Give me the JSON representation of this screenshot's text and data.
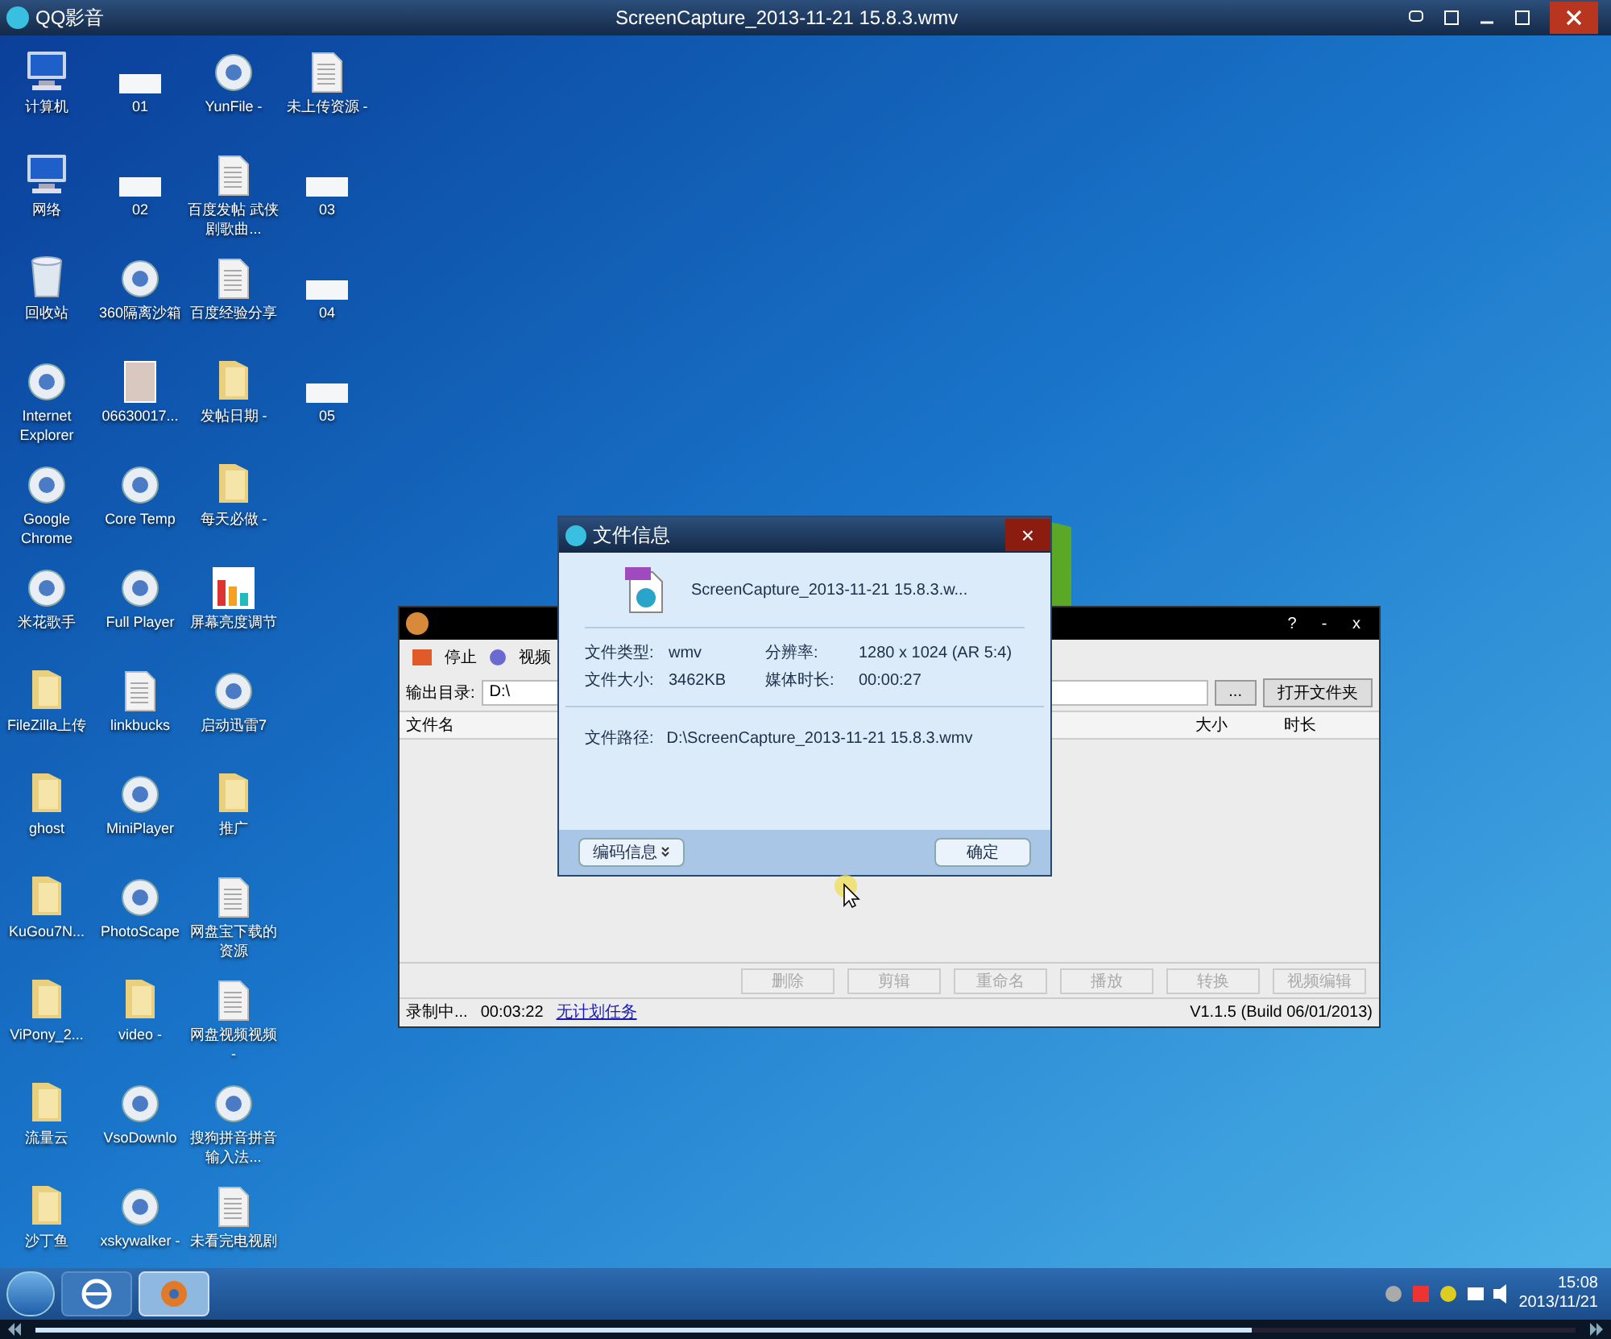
{
  "player": {
    "app_name": "QQ影音",
    "title": "ScreenCapture_2013-11-21 15.8.3.wmv",
    "progress": {
      "level": 0.79
    }
  },
  "desktop_rows": [
    [
      {
        "label": "计算机",
        "kind": "computer"
      },
      {
        "label": "01",
        "kind": "blank"
      },
      {
        "label": "YunFile -",
        "kind": "app"
      },
      {
        "label": "未上传资源 -",
        "kind": "document"
      }
    ],
    [
      {
        "label": "网络",
        "kind": "computer"
      },
      {
        "label": "02",
        "kind": "blank"
      },
      {
        "label": "百度发帖 武侠剧歌曲...",
        "kind": "document"
      },
      {
        "label": "03",
        "kind": "blank"
      }
    ],
    [
      {
        "label": "回收站",
        "kind": "bin"
      },
      {
        "label": "360隔离沙箱",
        "kind": "app"
      },
      {
        "label": "百度经验分享",
        "kind": "document"
      },
      {
        "label": "04",
        "kind": "blank"
      }
    ],
    [
      {
        "label": "Internet Explorer",
        "kind": "app"
      },
      {
        "label": "06630017...",
        "kind": "photo"
      },
      {
        "label": "发帖日期 -",
        "kind": "folder"
      },
      {
        "label": "05",
        "kind": "blank"
      }
    ],
    [
      {
        "label": "Google Chrome",
        "kind": "app"
      },
      {
        "label": "Core Temp",
        "kind": "app"
      },
      {
        "label": "每天必做 -",
        "kind": "folder"
      }
    ],
    [
      {
        "label": "米花歌手",
        "kind": "app"
      },
      {
        "label": "Full Player",
        "kind": "app"
      },
      {
        "label": "屏幕亮度调节",
        "kind": "chart"
      }
    ],
    [
      {
        "label": "FileZilla上传",
        "kind": "folder"
      },
      {
        "label": "linkbucks",
        "kind": "document"
      },
      {
        "label": "启动迅雷7",
        "kind": "app"
      }
    ],
    [
      {
        "label": "ghost",
        "kind": "folder"
      },
      {
        "label": "MiniPlayer",
        "kind": "app"
      },
      {
        "label": "推广",
        "kind": "folder"
      }
    ],
    [
      {
        "label": "KuGou7N...",
        "kind": "folder"
      },
      {
        "label": "PhotoScape",
        "kind": "app"
      },
      {
        "label": "网盘宝下载的资源",
        "kind": "document"
      }
    ],
    [
      {
        "label": "ViPony_2...",
        "kind": "folder"
      },
      {
        "label": "video -",
        "kind": "folder"
      },
      {
        "label": "网盘视频视频 -",
        "kind": "document"
      }
    ],
    [
      {
        "label": "流量云",
        "kind": "folder"
      },
      {
        "label": "VsoDownlo",
        "kind": "app"
      },
      {
        "label": "搜狗拼音拼音输入法...",
        "kind": "app"
      }
    ],
    [
      {
        "label": "沙丁鱼",
        "kind": "folder"
      },
      {
        "label": "xskywalker -",
        "kind": "app"
      },
      {
        "label": "未看完电视剧",
        "kind": "document"
      }
    ]
  ],
  "recorder": {
    "toolbar": [
      "停止",
      "视频"
    ],
    "output_label": "输出目录:",
    "output_value": "D:\\",
    "browse": "...",
    "open_folder": "打开文件夹",
    "window_buttons": [
      "?",
      "-",
      "x"
    ],
    "columns": [
      "文件名",
      "大小",
      "时长"
    ],
    "actions": [
      {
        "label": "删除",
        "disabled": true
      },
      {
        "label": "剪辑",
        "disabled": true
      },
      {
        "label": "重命名",
        "disabled": true
      },
      {
        "label": "播放",
        "disabled": true
      },
      {
        "label": "转换",
        "disabled": true
      },
      {
        "label": "视频编辑",
        "disabled": true
      }
    ],
    "status": {
      "state": "录制中...",
      "time": "00:03:22",
      "link": "无计划任务",
      "version": "V1.1.5 (Build 06/01/2013)"
    }
  },
  "dialog": {
    "title": "文件信息",
    "close": "×",
    "file_name": "ScreenCapture_2013-11-21 15.8.3.w...",
    "fields": [
      {
        "label": "文件类型:",
        "value": "wmv"
      },
      {
        "label": "分辨率:",
        "value": "1280 x 1024 (AR 5:4)"
      },
      {
        "label": "文件大小:",
        "value": "3462KB"
      },
      {
        "label": "媒体时长:",
        "value": "00:00:27"
      }
    ],
    "path_label": "文件路径:",
    "path_value": "D:\\ScreenCapture_2013-11-21 15.8.3.wmv",
    "codec_button": "编码信息",
    "ok_button": "确定"
  },
  "taskbar": {
    "items": [
      {
        "kind": "ie",
        "selected": false
      },
      {
        "kind": "player",
        "selected": true
      }
    ],
    "time": "15:08",
    "date": "2013/11/21"
  }
}
